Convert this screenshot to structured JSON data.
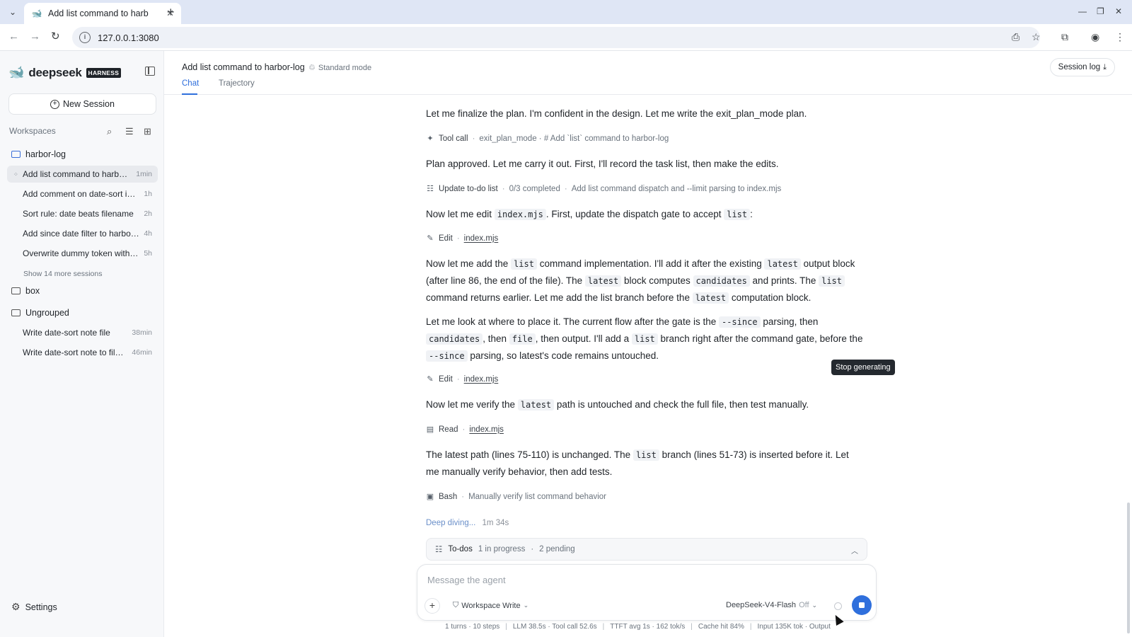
{
  "browser": {
    "tab_title": "Add list command to harb",
    "url": "127.0.0.1:3080"
  },
  "sidebar": {
    "brand": "deepseek",
    "brand_badge": "HARNESS",
    "new_session": "New Session",
    "workspaces_label": "Workspaces",
    "groups": [
      {
        "name": "harbor-log",
        "sessions": [
          {
            "title": "Add list command to harbor-log",
            "time": "1min"
          },
          {
            "title": "Add comment on date-sort in index.mjs",
            "time": "1h"
          },
          {
            "title": "Sort rule: date beats filename",
            "time": "2h"
          },
          {
            "title": "Add since date filter to harbor-log",
            "time": "4h"
          },
          {
            "title": "Overwrite dummy token with real",
            "time": "5h"
          }
        ],
        "more": "Show 14 more sessions"
      },
      {
        "name": "box",
        "sessions": []
      },
      {
        "name": "Ungrouped",
        "sessions": [
          {
            "title": "Write date-sort note file",
            "time": "38min"
          },
          {
            "title": "Write date-sort note to file notes",
            "time": "46min"
          }
        ]
      }
    ],
    "settings": "Settings"
  },
  "header": {
    "title": "Add list command to harbor-log",
    "mode": "Standard mode",
    "tabs": [
      "Chat",
      "Trajectory"
    ],
    "session_log": "Session log"
  },
  "messages": {
    "m1": "Let me finalize the plan. I'm confident in the design. Let me write the exit_plan_mode plan.",
    "tool1": {
      "name": "Tool call",
      "detail": "exit_plan_mode · # Add `list` command to harbor-log"
    },
    "m2": "Plan approved. Let me carry it out. First, I'll record the task list, then make the edits.",
    "tool2": {
      "name": "Update to-do list",
      "detail1": "0/3 completed",
      "detail2": "Add list command dispatch and --limit parsing to index.mjs"
    },
    "m3": {
      "t1": "Now let me edit ",
      "c1": "index.mjs",
      "t2": ". First, update the dispatch gate to accept ",
      "c2": "list",
      "t3": ":"
    },
    "tool3": {
      "name": "Edit",
      "file": "index.mjs"
    },
    "m4": {
      "t1": "Now let me add the ",
      "c1": "list",
      "t2": " command implementation. I'll add it after the existing ",
      "c2": "latest",
      "t3": " output block (after line 86, the end of the file). The ",
      "c3": "latest",
      "t4": " block computes ",
      "c4": "candidates",
      "t5": " and prints. The ",
      "c5": "list",
      "t6": " command returns earlier. Let me add the list branch before the ",
      "c6": "latest",
      "t7": " computation block."
    },
    "m5": {
      "t1": "Let me look at where to place it. The current flow after the gate is the ",
      "c1": "--since",
      "t2": " parsing, then ",
      "c2": "candidates",
      "t3": ", then ",
      "c3": "file",
      "t4": ", then output. I'll add a ",
      "c4": "list",
      "t5": " branch right after the command gate, before the ",
      "c5": "--since",
      "t6": " parsing, so latest's code remains untouched."
    },
    "tool4": {
      "name": "Edit",
      "file": "index.mjs"
    },
    "m6": {
      "t1": "Now let me verify the ",
      "c1": "latest",
      "t2": " path is untouched and check the full file, then test manually."
    },
    "tool5": {
      "name": "Read",
      "file": "index.mjs"
    },
    "m7": {
      "t1": "The latest path (lines 75-110) is unchanged. The ",
      "c1": "list",
      "t2": " branch (lines 51-73) is inserted before it. Let me manually verify behavior, then add tests."
    },
    "tool6": {
      "name": "Bash",
      "detail": "Manually verify list command behavior"
    },
    "status": {
      "label": "Deep diving...",
      "elapsed": "1m 34s"
    }
  },
  "todos": {
    "label": "To-dos",
    "in_progress": "1 in progress",
    "pending": "2 pending"
  },
  "composer": {
    "placeholder": "Message the agent",
    "permission": "Workspace Write",
    "model": "DeepSeek-V4-Flash",
    "thinking": "Off"
  },
  "tooltip": "Stop generating",
  "stats": [
    "1 turns · 10 steps",
    "LLM 38.5s · Tool call 52.6s",
    "TTFT avg 1s · 162 tok/s",
    "Cache hit 84%",
    "Input 135K tok · Output"
  ],
  "colors": {
    "accent": "#2f6fdc",
    "sidebar_bg": "#f7f8fa",
    "tab_strip": "#dfe6f5"
  }
}
